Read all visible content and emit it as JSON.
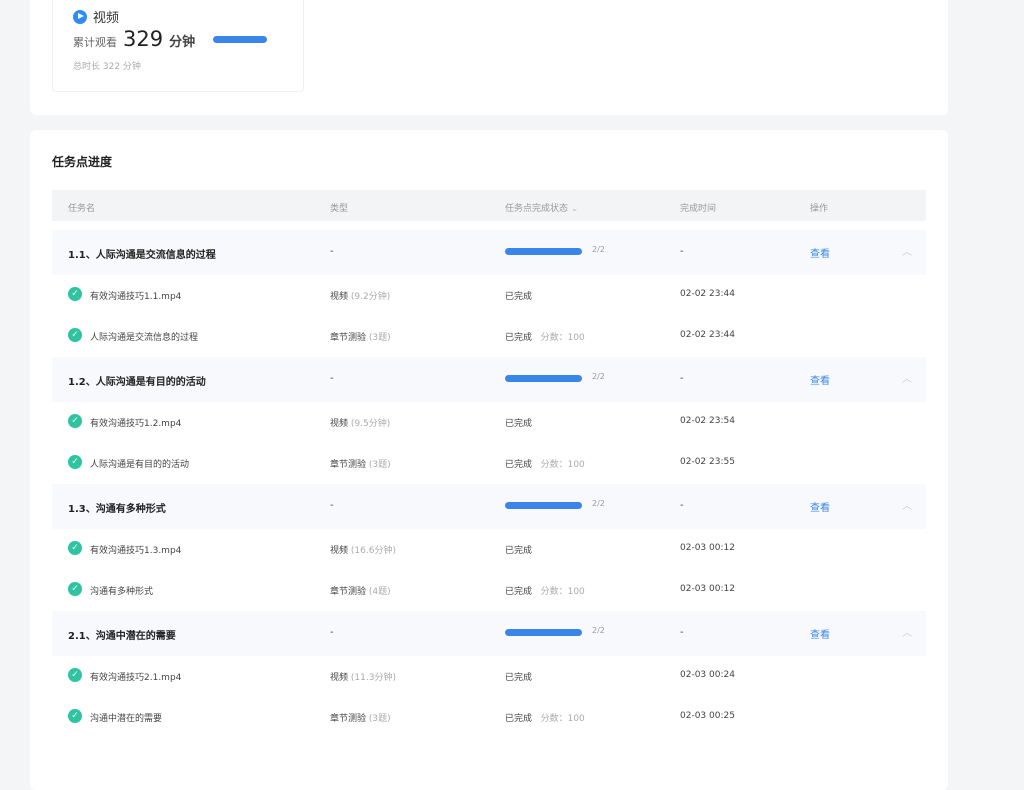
{
  "video_card": {
    "title": "视频",
    "watched_label": "累计观看",
    "watched_value": "329",
    "watched_unit": "分钟",
    "progress": 1.0,
    "total": "总时长 322 分钟"
  },
  "tasks": {
    "title": "任务点进度",
    "columns": [
      "任务名",
      "类型",
      "任务点完成状态",
      "完成时间",
      "操作"
    ],
    "groups": [
      {
        "name": "1.1、人际沟通是交流信息的过程",
        "type": "-",
        "progress": "2/2",
        "time": "-",
        "action": "查看",
        "children": [
          {
            "name": "有效沟通技巧1.1.mp4",
            "type": "视频",
            "detail": "(9.2分钟)",
            "status": "已完成",
            "score": "",
            "time": "02-02 23:44"
          },
          {
            "name": "人际沟通是交流信息的过程",
            "type": "章节测验",
            "detail": "(3题)",
            "status": "已完成",
            "score": "分数：100",
            "time": "02-02 23:44"
          }
        ]
      },
      {
        "name": "1.2、人际沟通是有目的的活动",
        "type": "-",
        "progress": "2/2",
        "time": "-",
        "action": "查看",
        "children": [
          {
            "name": "有效沟通技巧1.2.mp4",
            "type": "视频",
            "detail": "(9.5分钟)",
            "status": "已完成",
            "score": "",
            "time": "02-02 23:54"
          },
          {
            "name": "人际沟通是有目的的活动",
            "type": "章节测验",
            "detail": "(3题)",
            "status": "已完成",
            "score": "分数：100",
            "time": "02-02 23:55"
          }
        ]
      },
      {
        "name": "1.3、沟通有多种形式",
        "type": "-",
        "progress": "2/2",
        "time": "-",
        "action": "查看",
        "children": [
          {
            "name": "有效沟通技巧1.3.mp4",
            "type": "视频",
            "detail": "(16.6分钟)",
            "status": "已完成",
            "score": "",
            "time": "02-03 00:12"
          },
          {
            "name": "沟通有多种形式",
            "type": "章节测验",
            "detail": "(4题)",
            "status": "已完成",
            "score": "分数：100",
            "time": "02-03 00:12"
          }
        ]
      },
      {
        "name": "2.1、沟通中潜在的需要",
        "type": "-",
        "progress": "2/2",
        "time": "-",
        "action": "查看",
        "children": [
          {
            "name": "有效沟通技巧2.1.mp4",
            "type": "视频",
            "detail": "(11.3分钟)",
            "status": "已完成",
            "score": "",
            "time": "02-03 00:24"
          },
          {
            "name": "沟通中潜在的需要",
            "type": "章节测验",
            "detail": "(3题)",
            "status": "已完成",
            "score": "分数：100",
            "time": "02-03 00:25"
          }
        ]
      }
    ]
  }
}
